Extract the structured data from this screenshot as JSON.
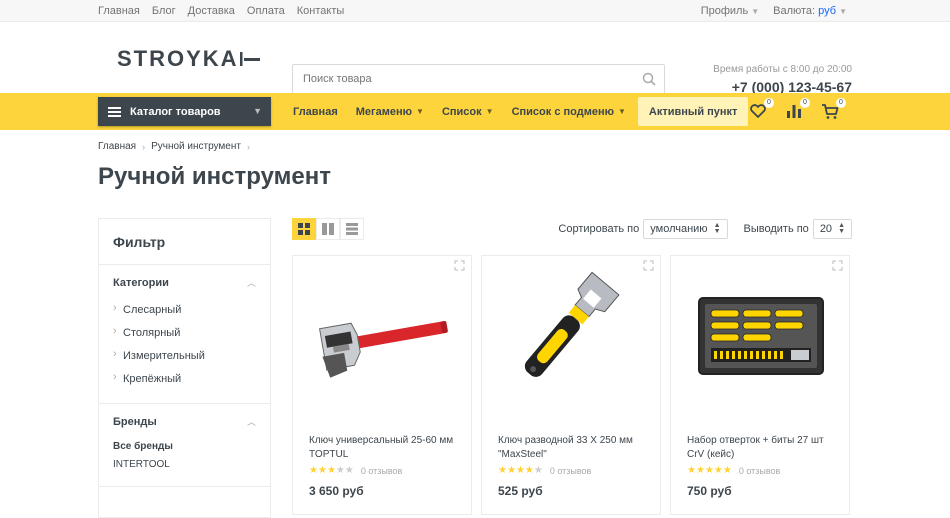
{
  "topbar": {
    "links": [
      "Главная",
      "Блог",
      "Доставка",
      "Оплата",
      "Контакты"
    ],
    "profile_label": "Профиль",
    "currency_label": "Валюта:",
    "currency_value": "руб"
  },
  "header": {
    "logo": "STROYKA",
    "search_placeholder": "Поиск товара",
    "work_hours": "Время работы с 8:00 до 20:00",
    "phone": "+7 (000) 123-45-67"
  },
  "nav": {
    "catalog_label": "Каталог товаров",
    "items": [
      {
        "label": "Главная",
        "has_dropdown": false
      },
      {
        "label": "Мегаменю",
        "has_dropdown": true
      },
      {
        "label": "Список",
        "has_dropdown": true
      },
      {
        "label": "Список с подменю",
        "has_dropdown": true
      },
      {
        "label": "Активный пункт",
        "has_dropdown": false
      }
    ],
    "wishlist_count": "0",
    "compare_count": "0",
    "cart_count": "0"
  },
  "breadcrumb": [
    "Главная",
    "Ручной инструмент"
  ],
  "page_title": "Ручной инструмент",
  "filter": {
    "title": "Фильтр",
    "categories_title": "Категории",
    "categories": [
      "Слесарный",
      "Столярный",
      "Измерительный",
      "Крепёжный"
    ],
    "brands_title": "Бренды",
    "brands": [
      "Все бренды",
      "INTERTOOL"
    ]
  },
  "toolbar": {
    "sort_label": "Сортировать по",
    "sort_value": "умолчанию",
    "show_label": "Выводить по",
    "show_value": "20"
  },
  "products": [
    {
      "name": "Ключ универсальный 25-60 мм TOPTUL",
      "rating": 3,
      "reviews": "0 отзывов",
      "price": "3 650 руб"
    },
    {
      "name": "Ключ разводной 33 X 250 мм \"MaxSteel\"",
      "rating": 4,
      "reviews": "0 отзывов",
      "price": "525 руб"
    },
    {
      "name": "Набор отверток + биты 27 шт CrV (кейс)",
      "rating": 5,
      "reviews": "0 отзывов",
      "price": "750 руб"
    }
  ],
  "colors": {
    "accent": "#fdd43b",
    "dark": "#3d464d",
    "star": "#ffd333"
  }
}
